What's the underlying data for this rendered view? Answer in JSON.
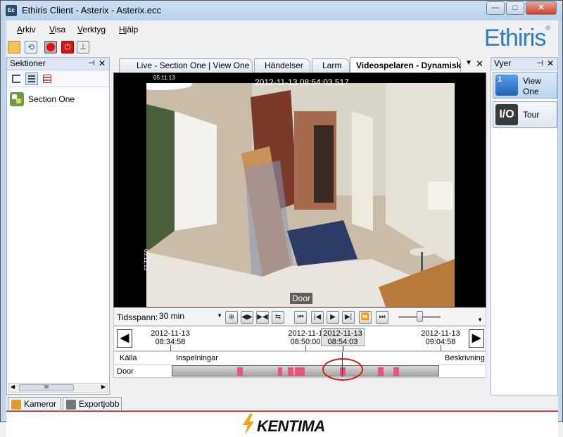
{
  "window": {
    "title": "Ethiris Client - Asterix - Asterix.ecc",
    "app_icon": "Ec",
    "brand": "Ethiris",
    "brand_mark": "®"
  },
  "menu": {
    "items": [
      {
        "label": "Arkiv",
        "accel": "A",
        "rest": "rkiv"
      },
      {
        "label": "Visa",
        "accel": "V",
        "rest": "isa"
      },
      {
        "label": "Verktyg",
        "accel": "V",
        "rest": "erktyg"
      },
      {
        "label": "Hjälp",
        "accel": "H",
        "rest": "jälp"
      }
    ]
  },
  "toolbar": {
    "icons": [
      "folder-icon",
      "refresh-icon",
      "record-icon",
      "power-icon",
      "stamp-icon"
    ]
  },
  "sections_panel": {
    "title": "Sektioner",
    "pin": "⊣",
    "close": "✕",
    "items": [
      {
        "label": "Section One"
      }
    ],
    "scroll_label": "III"
  },
  "tabs": [
    {
      "label": "Live - Section One | View One",
      "active": false
    },
    {
      "label": "Händelser",
      "active": false
    },
    {
      "label": "Larm",
      "active": false
    },
    {
      "label": "Videospelaren - Dynamisk",
      "active": true
    }
  ],
  "tab_menu": "▼",
  "tab_close": "✕",
  "video": {
    "timestamp": "2012-11-13 08:54:03.517",
    "osd_small": "05:11:13",
    "osd_side": "05:11:13",
    "camera_label": "Door"
  },
  "controls": {
    "timespan_label": "Tidsspann:",
    "timespan_value": "30 min",
    "dropdown_arrow": "▼"
  },
  "timeline": {
    "labels": [
      {
        "date": "2012-11-13",
        "time": "08:34:58"
      },
      {
        "date": "2012-11-1",
        "time": "08:50:00"
      },
      {
        "date": "2012-11-13",
        "time": "09:04:58"
      }
    ],
    "cursor": {
      "date": "2012-11-13",
      "time": "08:54:03"
    },
    "prev": "◀",
    "next": "▶"
  },
  "recordings": {
    "headers": {
      "source": "Källa",
      "recordings": "Inspelningar",
      "description": "Beskrivning"
    },
    "rows": [
      {
        "source": "Door",
        "description": ""
      }
    ]
  },
  "views_panel": {
    "title": "Vyer",
    "pin": "⊣",
    "close": "✕",
    "items": [
      {
        "label_line1": "View",
        "label_line2": "One",
        "icon_text": "1"
      },
      {
        "label_line1": "Tour",
        "label_line2": "",
        "icon_text": "I/O"
      }
    ]
  },
  "bottom_tabs": [
    {
      "label": "Kameror"
    },
    {
      "label": "Exportjobb"
    }
  ],
  "footer": {
    "logo": "KENTIMA"
  },
  "colors": {
    "recording_segment": "#e9557a",
    "highlight_circle": "#d41b1b",
    "brand_blue": "#2a7fc4"
  }
}
